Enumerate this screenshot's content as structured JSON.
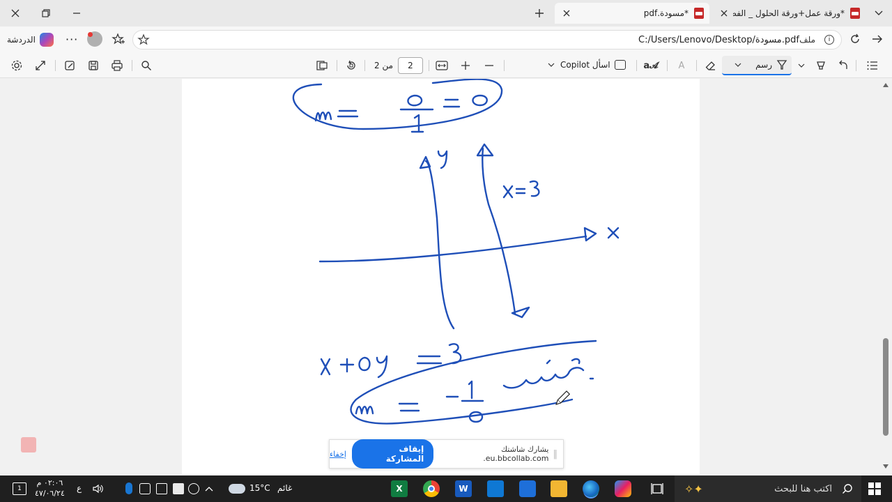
{
  "browser": {
    "tabs": [
      {
        "title": "*ورقة عمل+ورقة الحلول _ الفصل الـ",
        "active": false
      },
      {
        "title": "*مسودة.pdf",
        "active": true
      }
    ],
    "address": "C:/Users/Lenovo/Desktop/مسودة.pdf",
    "file_label": "ملف",
    "chat_label": "الدردشة"
  },
  "toolbar": {
    "draw_label": "رسم",
    "copilot_label": "اسأل Copilot",
    "page_current": "2",
    "page_of": "من 2"
  },
  "page": {
    "eq_slope_zero": "m = 0/1 = 0",
    "axis_y": "y",
    "axis_x": "x",
    "line_label": "x=3",
    "eq_line": "x + 0y = 3",
    "eq_slope_undef": "m = -1/0",
    "undefined_word": "غير معرف"
  },
  "share": {
    "message": "يشارك شاشتك eu.bbcollab.com.",
    "stop_label": "إيقاف المشاركة",
    "hide_label": "إخفاء"
  },
  "taskbar": {
    "search_placeholder": "اكتب هنا للبحث",
    "weather_temp": "15°C",
    "weather_text": "غائم",
    "time": "٠٢:٠٦ م",
    "date": "٤٧/٠٦/٢٤",
    "lang": "ع",
    "notifications": "1"
  },
  "colors": {
    "ink": "#1f4fb8",
    "accent": "#1a73e8",
    "pdf_red": "#c62828"
  }
}
